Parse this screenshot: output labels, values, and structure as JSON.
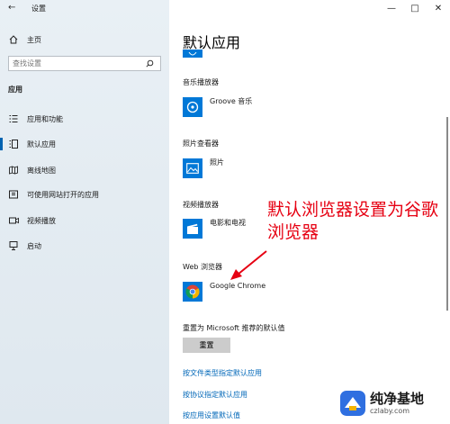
{
  "window": {
    "title": "设置",
    "back_icon": "back-arrow-icon",
    "controls": {
      "minimize": "—",
      "maximize": "□",
      "close": "✕"
    }
  },
  "sidebar": {
    "home": {
      "label": "主页",
      "icon": "home-icon"
    },
    "search": {
      "placeholder": "查找设置",
      "icon": "search-icon"
    },
    "section": "应用",
    "items": [
      {
        "label": "应用和功能",
        "icon": "apps-list-icon",
        "selected": false
      },
      {
        "label": "默认应用",
        "icon": "default-apps-icon",
        "selected": true
      },
      {
        "label": "离线地图",
        "icon": "offline-map-icon",
        "selected": false
      },
      {
        "label": "可使用网站打开的应用",
        "icon": "website-apps-icon",
        "selected": false
      },
      {
        "label": "视频播放",
        "icon": "video-playback-icon",
        "selected": false
      },
      {
        "label": "启动",
        "icon": "startup-icon",
        "selected": false
      }
    ]
  },
  "main": {
    "title": "默认应用",
    "sections": [
      {
        "heading": "音乐播放器",
        "app": "Groove 音乐",
        "icon": "groove-music-icon"
      },
      {
        "heading": "照片查看器",
        "app": "照片",
        "icon": "photos-icon"
      },
      {
        "heading": "视频播放器",
        "app": "电影和电视",
        "icon": "movies-tv-icon"
      },
      {
        "heading": "Web 浏览器",
        "app": "Google Chrome",
        "icon": "chrome-icon"
      }
    ],
    "reset": {
      "label": "重置为 Microsoft 推荐的默认值",
      "button": "重置"
    },
    "links": [
      "按文件类型指定默认应用",
      "按协议指定默认应用",
      "按应用设置默认值"
    ]
  },
  "annotation": {
    "line1": "默认浏览器设置为谷歌",
    "line2": "浏览器",
    "color": "#e60012"
  },
  "watermark": {
    "brand": "纯净基地",
    "url": "czlaby.com"
  },
  "colors": {
    "accent": "#0078d7",
    "link": "#0067b8",
    "sidebar_bg": "#e6eef4"
  }
}
